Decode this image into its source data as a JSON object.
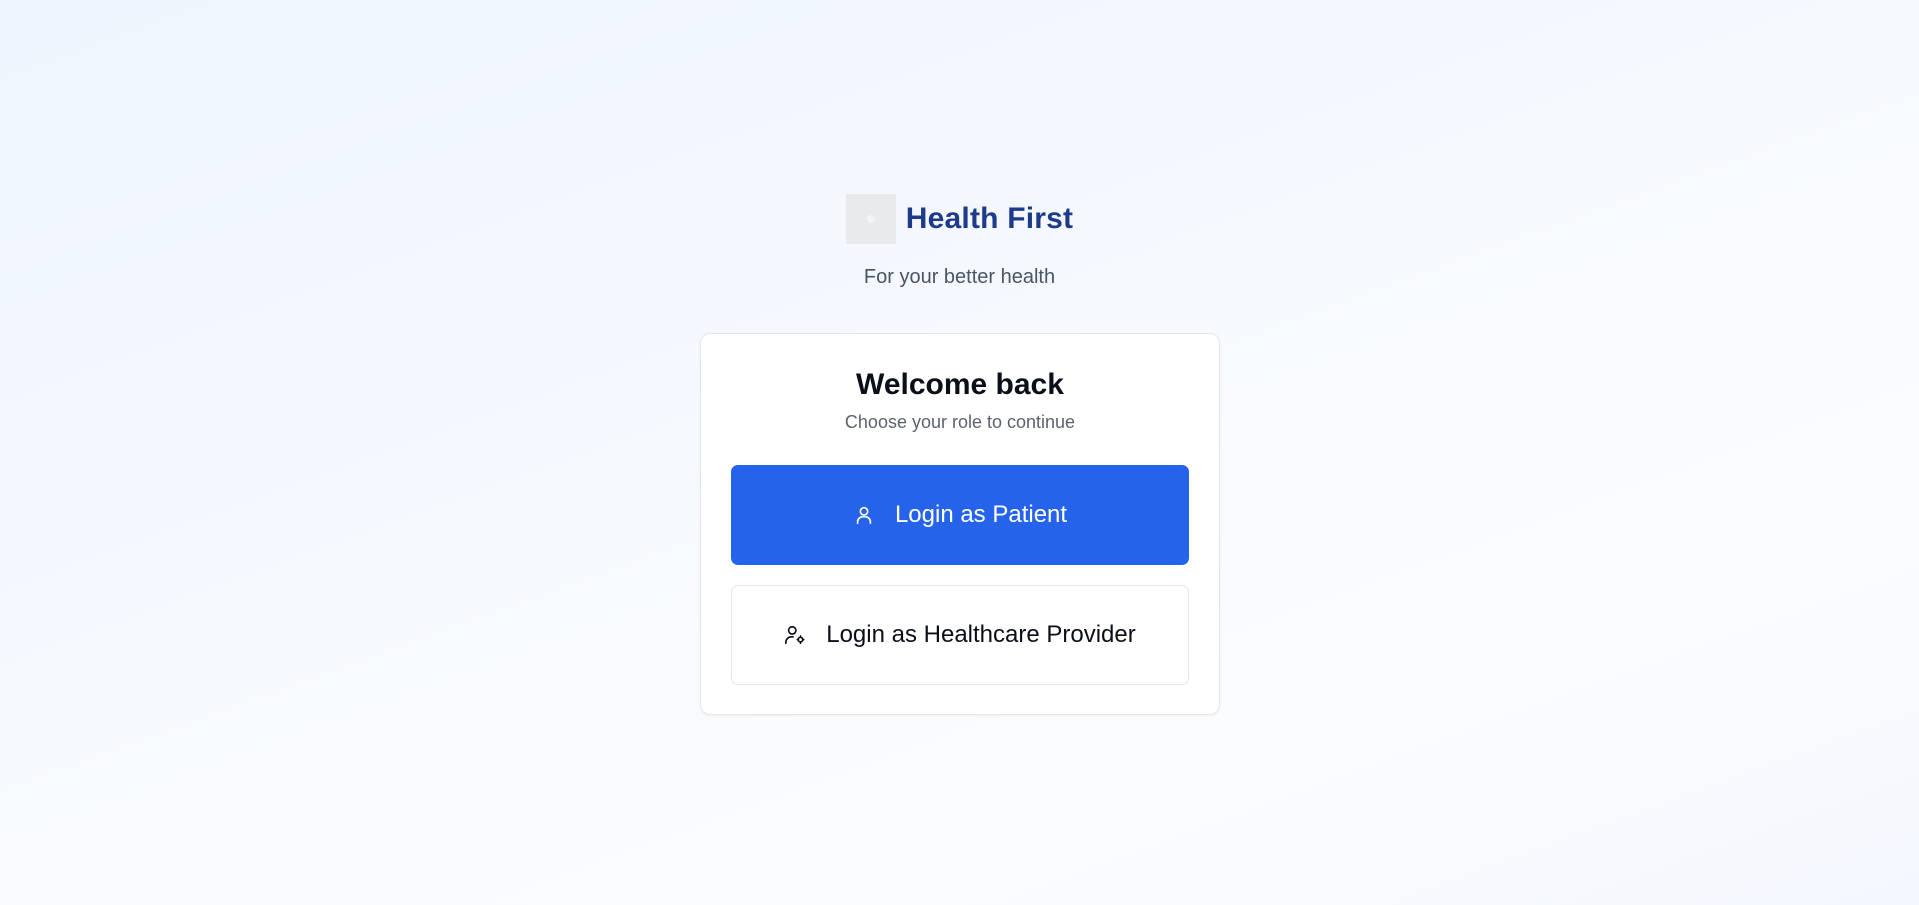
{
  "app": {
    "name": "Health First",
    "tagline": "For your better health",
    "logo_icon": "logo-placeholder",
    "brand_color": "#1e3a8a",
    "accent_color": "#2563eb"
  },
  "card": {
    "title": "Welcome back",
    "subtitle": "Choose your role to continue",
    "buttons": {
      "patient": {
        "label": "Login as Patient",
        "icon": "user-icon"
      },
      "provider": {
        "label": "Login as Healthcare Provider",
        "icon": "user-cog-icon"
      }
    }
  }
}
